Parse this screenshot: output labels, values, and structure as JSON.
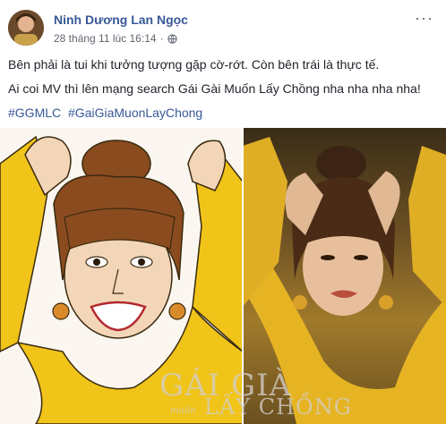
{
  "post": {
    "author": "Ninh Dương Lan Ngọc",
    "timestamp": "28 tháng 11 lúc 16:14",
    "separator": "·",
    "privacy_icon": "globe-icon",
    "more_label": "···",
    "lines": [
      "Bên phải là tui khi tưởng tượng gặp cờ-rớt. Còn bên trái là thực tế.",
      "Ai coi MV thì lên mạng search Gái Gài Muốn Lấy Chồng nha nha nha nha!"
    ],
    "hashtags": [
      "#GGMLC",
      "#GaiGiaMuonLayChong"
    ]
  },
  "photo": {
    "watermark_title": "GÁI GIÀ",
    "watermark_small": "muốn",
    "watermark_bottom": "LẤY CHỒNG"
  },
  "colors": {
    "link": "#385898",
    "text": "#1d2129",
    "meta": "#616770",
    "yellow": "#f0c419"
  }
}
